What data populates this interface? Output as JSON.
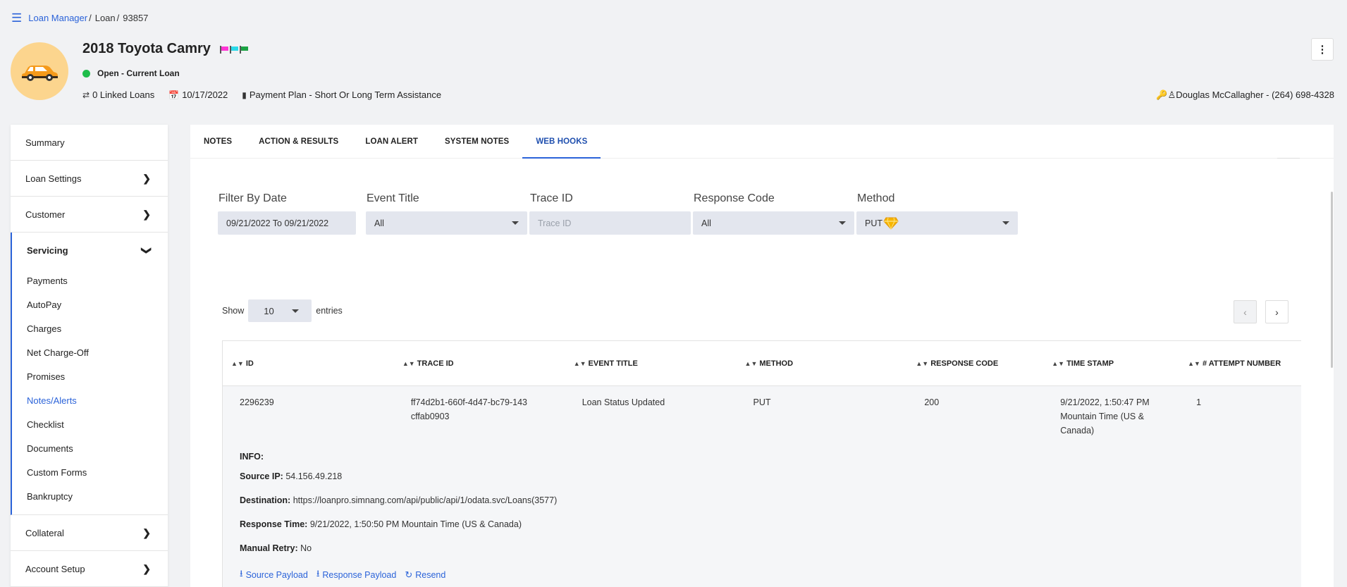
{
  "breadcrumb": {
    "root": "Loan Manager",
    "level2": "Loan",
    "level3": "93857"
  },
  "header": {
    "title": "2018 Toyota Camry",
    "status": "Open - Current Loan",
    "linked_loans": "0 Linked Loans",
    "date": "10/17/2022",
    "payment_plan": "Payment Plan - Short Or Long Term Assistance",
    "contact": "Douglas McCallagher - (264) 698-4328",
    "flags": [
      "pink",
      "cyan",
      "green"
    ],
    "status_color": "#1fbd4a"
  },
  "sidebar": {
    "items_top": [
      {
        "label": "Summary"
      },
      {
        "label": "Loan Settings"
      },
      {
        "label": "Customer"
      }
    ],
    "servicing": {
      "label": "Servicing",
      "subitems": [
        "Payments",
        "AutoPay",
        "Charges",
        "Net Charge-Off",
        "Promises",
        "Notes/Alerts",
        "Checklist",
        "Documents",
        "Custom Forms",
        "Bankruptcy"
      ]
    },
    "items_bottom": [
      {
        "label": "Collateral"
      },
      {
        "label": "Account Setup"
      }
    ]
  },
  "tabs": [
    "NOTES",
    "ACTION & RESULTS",
    "LOAN ALERT",
    "SYSTEM NOTES",
    "WEB HOOKS"
  ],
  "filters": {
    "date": {
      "label": "Filter By Date",
      "value": "09/21/2022 To 09/21/2022"
    },
    "event": {
      "label": "Event Title",
      "value": "All"
    },
    "trace": {
      "label": "Trace ID",
      "placeholder": "Trace ID"
    },
    "response": {
      "label": "Response Code",
      "value": "All"
    },
    "method": {
      "label": "Method",
      "value": "PUT"
    }
  },
  "entries": {
    "show": "Show",
    "value": "10",
    "suffix": "entries"
  },
  "table": {
    "headers": [
      "ID",
      "TRACE ID",
      "EVENT TITLE",
      "METHOD",
      "RESPONSE CODE",
      "TIME STAMP",
      "# ATTEMPT NUMBER"
    ],
    "row": {
      "id": "2296239",
      "trace_id": "ff74d2b1-660f-4d47-bc79-143cffab0903",
      "event_title": "Loan Status Updated",
      "method": "PUT",
      "response_code": "200",
      "timestamp": "9/21/2022, 1:50:47 PM Mountain Time (US & Canada)",
      "attempt": "1"
    },
    "info": {
      "heading": "INFO:",
      "source_ip_label": "Source IP:",
      "source_ip": "54.156.49.218",
      "destination_label": "Destination:",
      "destination": "https://loanpro.simnang.com/api/public/api/1/odata.svc/Loans(3577)",
      "response_time_label": "Response Time:",
      "response_time": "9/21/2022, 1:50:50 PM Mountain Time (US & Canada)",
      "manual_retry_label": "Manual Retry:",
      "manual_retry": "No",
      "links": [
        "Source Payload",
        "Response Payload",
        "Resend"
      ]
    }
  }
}
